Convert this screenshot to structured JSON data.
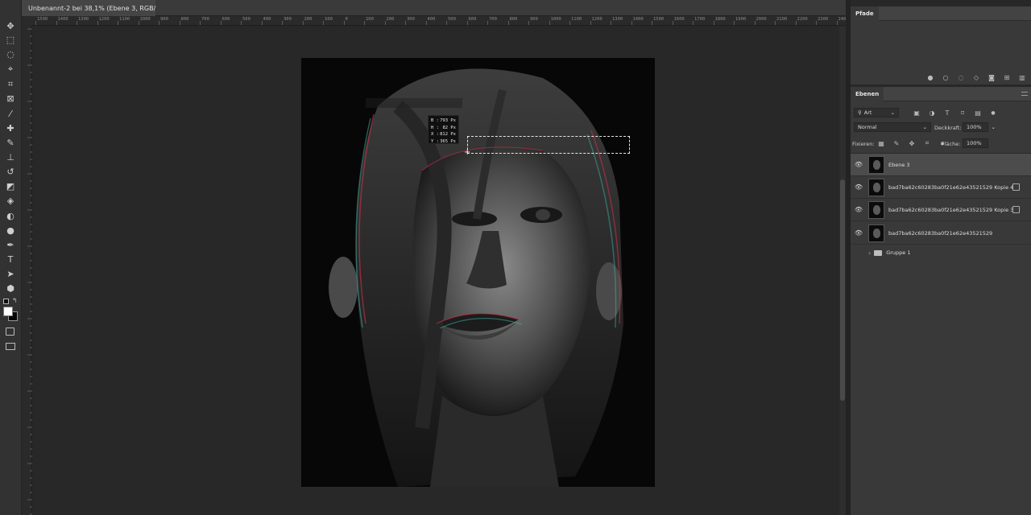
{
  "document": {
    "tab_title": "Unbenannt-2 bei 38,1% (Ebene 3, RGB/8) *",
    "close_glyph": "×"
  },
  "ruler": {
    "ticks": [
      "1500",
      "1400",
      "1300",
      "1200",
      "1100",
      "1000",
      "900",
      "800",
      "700",
      "600",
      "500",
      "400",
      "300",
      "200",
      "100",
      "0",
      "100",
      "200",
      "300",
      "400",
      "500",
      "600",
      "700",
      "800",
      "900",
      "1000",
      "1100",
      "1200",
      "1300",
      "1400",
      "1500",
      "1600",
      "1700",
      "1800",
      "1900",
      "2000",
      "2100",
      "2200",
      "2300",
      "2400",
      "2500",
      "2600",
      "2700",
      "2800",
      "2900",
      "3000"
    ]
  },
  "tools": [
    {
      "name": "move-tool-icon",
      "glyph": "✥"
    },
    {
      "name": "marquee-tool-icon",
      "glyph": "⬚"
    },
    {
      "name": "lasso-tool-icon",
      "glyph": "◌"
    },
    {
      "name": "quick-select-tool-icon",
      "glyph": "⌖"
    },
    {
      "name": "crop-tool-icon",
      "glyph": "⌗"
    },
    {
      "name": "frame-tool-icon",
      "glyph": "⊠"
    },
    {
      "name": "eyedropper-tool-icon",
      "glyph": "⁄"
    },
    {
      "name": "healing-brush-tool-icon",
      "glyph": "✚"
    },
    {
      "name": "brush-tool-icon",
      "glyph": "✎"
    },
    {
      "name": "clone-stamp-tool-icon",
      "glyph": "⊥"
    },
    {
      "name": "history-brush-tool-icon",
      "glyph": "↺"
    },
    {
      "name": "eraser-tool-icon",
      "glyph": "◩"
    },
    {
      "name": "paint-bucket-tool-icon",
      "glyph": "◈"
    },
    {
      "name": "blur-tool-icon",
      "glyph": "◐"
    },
    {
      "name": "dodge-tool-icon",
      "glyph": "●"
    },
    {
      "name": "pen-tool-icon",
      "glyph": "✒"
    },
    {
      "name": "type-tool-icon",
      "glyph": "T"
    },
    {
      "name": "path-selection-tool-icon",
      "glyph": "➤"
    },
    {
      "name": "shape-tool-icon",
      "glyph": "⬢"
    },
    {
      "name": "more-tools-icon",
      "glyph": "•••"
    }
  ],
  "measure": {
    "b_label": "B :",
    "b_value": "793 Px",
    "h_label": "H :",
    "h_value": "82 Px",
    "x_label": "X :",
    "x_value": "812 Px",
    "y_label": "Y :",
    "y_value": "365 Px"
  },
  "paths_panel": {
    "title": "Pfade"
  },
  "layers_panel": {
    "title": "Ebenen",
    "filter_kind": "Art",
    "blend_mode": "Normal",
    "opacity_label": "Deckkraft:",
    "opacity_value": "100%",
    "lock_label": "Fixieren:",
    "fill_label": "Fläche:",
    "fill_value": "100%",
    "layers": [
      {
        "name": "Ebene 3",
        "active": true,
        "smart": false
      },
      {
        "name": "bad7ba62c60283ba0f21e62e43521529  Kopie  4",
        "active": false,
        "smart": true
      },
      {
        "name": "bad7ba62c60283ba0f21e62e43521529  Kopie  3",
        "active": false,
        "smart": true
      },
      {
        "name": "bad7ba62c60283ba0f21e62e43521529",
        "active": false,
        "smart": false
      }
    ],
    "group_name": "Gruppe 1"
  },
  "colors": {
    "accent_red": "#d0304a",
    "accent_cyan": "#3fb8a6",
    "active_layer": "#4c4c4c"
  }
}
